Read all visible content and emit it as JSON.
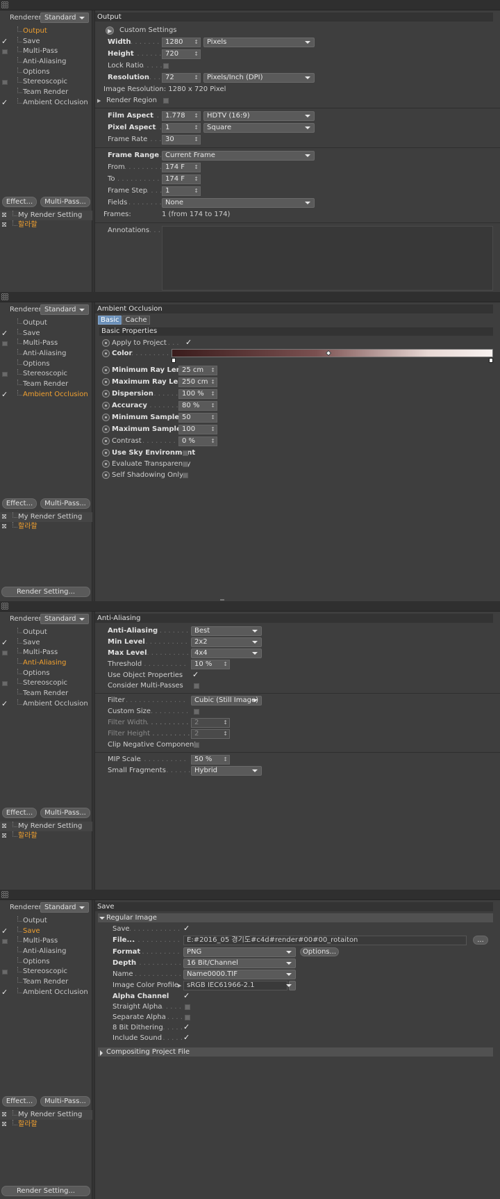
{
  "renderer": {
    "label": "Renderer",
    "value": "Standard"
  },
  "tree": [
    "Output",
    "Save",
    "Multi-Pass",
    "Anti-Aliasing",
    "Options",
    "Stereoscopic",
    "Team Render",
    "Ambient Occlusion"
  ],
  "buttons": {
    "effect": "Effect...",
    "multipass": "Multi-Pass...",
    "render_setting": "Render Setting..."
  },
  "render_settings": [
    "My Render Setting",
    "할라할"
  ],
  "output": {
    "title": "Output",
    "preset": "Custom Settings",
    "width": {
      "label": "Width",
      "value": "1280",
      "unit": "Pixels"
    },
    "height": {
      "label": "Height",
      "value": "720"
    },
    "lock_ratio": "Lock Ratio",
    "resolution": {
      "label": "Resolution",
      "value": "72",
      "unit": "Pixels/Inch (DPI)"
    },
    "image_resolution": "Image Resolution: 1280 x 720 Pixel",
    "render_region": "Render Region",
    "film_aspect": {
      "label": "Film Aspect",
      "value": "1.778",
      "preset": "HDTV (16:9)"
    },
    "pixel_aspect": {
      "label": "Pixel Aspect",
      "value": "1",
      "preset": "Square"
    },
    "frame_rate": {
      "label": "Frame Rate",
      "value": "30"
    },
    "frame_range": {
      "label": "Frame Range",
      "value": "Current Frame"
    },
    "from": {
      "label": "From",
      "value": "174 F"
    },
    "to": {
      "label": "To",
      "value": "174 F"
    },
    "frame_step": {
      "label": "Frame Step",
      "value": "1"
    },
    "fields": {
      "label": "Fields",
      "value": "None"
    },
    "frames": {
      "label": "Frames:",
      "value": "1 (from 174 to 174)"
    },
    "annotations": "Annotations"
  },
  "ao": {
    "title": "Ambient Occlusion",
    "tabs": [
      "Basic",
      "Cache"
    ],
    "subheader": "Basic Properties",
    "apply": "Apply to Project",
    "color": "Color",
    "min_ray": {
      "label": "Minimum Ray Length",
      "value": "25 cm"
    },
    "max_ray": {
      "label": "Maximum Ray Length",
      "value": "250 cm"
    },
    "dispersion": {
      "label": "Dispersion",
      "value": "100 %"
    },
    "accuracy": {
      "label": "Accuracy",
      "value": "80 %"
    },
    "min_samples": {
      "label": "Minimum Samples",
      "value": "50"
    },
    "max_samples": {
      "label": "Maximum Samples",
      "value": "100"
    },
    "contrast": {
      "label": "Contrast",
      "value": "0 %"
    },
    "sky": "Use Sky Environment",
    "eval_transp": "Evaluate Transparency",
    "self_shadow": "Self Shadowing Only"
  },
  "aa": {
    "title": "Anti-Aliasing",
    "anti_aliasing": {
      "label": "Anti-Aliasing",
      "value": "Best"
    },
    "min_level": {
      "label": "Min Level",
      "value": "2x2"
    },
    "max_level": {
      "label": "Max Level",
      "value": "4x4"
    },
    "threshold": {
      "label": "Threshold",
      "value": "10 %"
    },
    "use_obj": "Use Object Properties",
    "consider_mp": "Consider Multi-Passes",
    "filter": {
      "label": "Filter",
      "value": "Cubic (Still Image)"
    },
    "custom_size": "Custom Size",
    "filter_width": {
      "label": "Filter Width",
      "value": "2"
    },
    "filter_height": {
      "label": "Filter Height",
      "value": "2"
    },
    "clip_neg": "Clip Negative Component",
    "mip": {
      "label": "MIP Scale",
      "value": "50 %"
    },
    "small_frag": {
      "label": "Small Fragments",
      "value": "Hybrid"
    }
  },
  "save": {
    "title": "Save",
    "regular": "Regular Image",
    "save_lbl": "Save",
    "file": {
      "label": "File...",
      "value": "E:#2016_05 경기도#c4d#render#00#00_rotaiton"
    },
    "format": {
      "label": "Format",
      "value": "PNG",
      "options": "Options..."
    },
    "depth": {
      "label": "Depth",
      "value": "16 Bit/Channel"
    },
    "name": {
      "label": "Name",
      "value": "Name0000.TIF"
    },
    "profile": {
      "label": "Image Color Profile",
      "value": "sRGB IEC61966-2.1"
    },
    "alpha": "Alpha Channel",
    "straight": "Straight Alpha",
    "separate": "Separate Alpha",
    "dither": "8 Bit Dithering",
    "sound": "Include Sound",
    "compositing": "Compositing Project File",
    "browse": "..."
  }
}
